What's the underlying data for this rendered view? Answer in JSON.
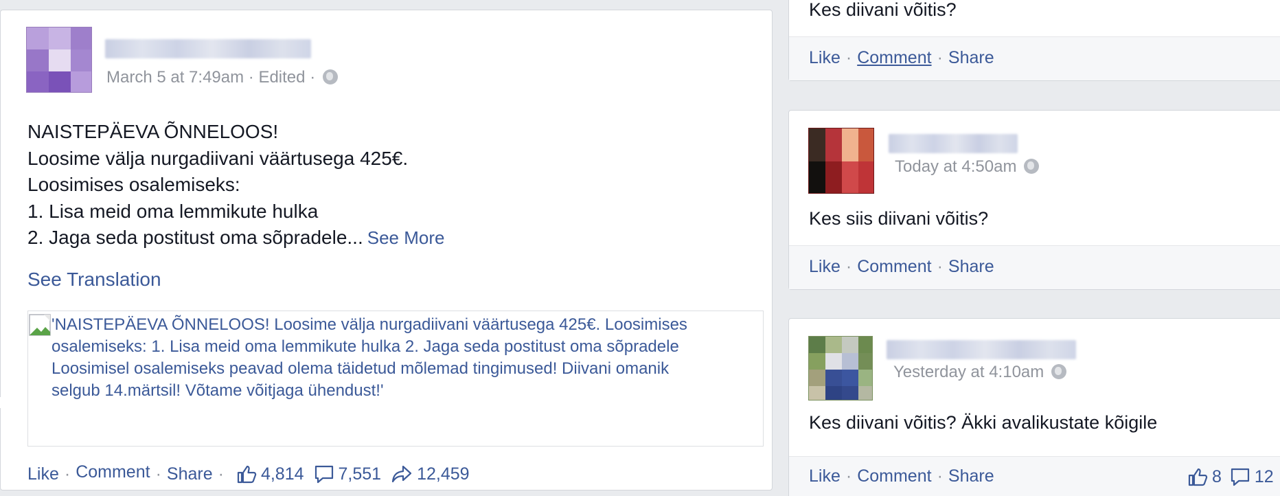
{
  "main_post": {
    "timestamp": "March 5 at 7:49am",
    "edited": "Edited",
    "separator": "·",
    "body_lines": [
      "NAISTEPÄEVA ÕNNELOOS!",
      "Loosime välja nurgadiivani väärtusega 425€.",
      "Loosimises osalemiseks:",
      "1. Lisa meid oma lemmikute hulka",
      "2. Jaga seda postitust oma sõpradele..."
    ],
    "see_more": "See More",
    "see_translation": "See Translation",
    "link_preview_lines": [
      "'NAISTEPÄEVA ÕNNELOOS! Loosime välja nurgadiivani väärtusega 425€. Loosimises",
      "osalemiseks: 1. Lisa meid oma lemmikute hulka 2. Jaga seda postitust oma sõpradele",
      "Loosimisel osalemiseks peavad olema täidetud mõlemad tingimused! Diivani omanik",
      "selgub 14.märtsil! Võtame võitjaga ühendust!'"
    ],
    "actions": {
      "like": "Like",
      "comment": "Comment",
      "share": "Share"
    },
    "counts": {
      "likes": "4,814",
      "comments": "7,551",
      "shares": "12,459"
    }
  },
  "comments": [
    {
      "text": "Kes diivani võitis?",
      "actions": {
        "like": "Like",
        "comment": "Comment",
        "share": "Share"
      }
    },
    {
      "timestamp": "Today at 4:50am",
      "text": "Kes siis diivani võitis?",
      "actions": {
        "like": "Like",
        "comment": "Comment",
        "share": "Share"
      }
    },
    {
      "timestamp": "Yesterday at 4:10am",
      "text": "Kes diivani võitis? Äkki avalikustate kõigile",
      "actions": {
        "like": "Like",
        "comment": "Comment",
        "share": "Share"
      },
      "counts": {
        "likes": "8",
        "comments": "12"
      }
    }
  ],
  "colors": {
    "link": "#3b5998",
    "meta": "#90949c",
    "text": "#141823",
    "page_bg": "#e9ebee",
    "footer_bg": "#f6f7f9"
  }
}
